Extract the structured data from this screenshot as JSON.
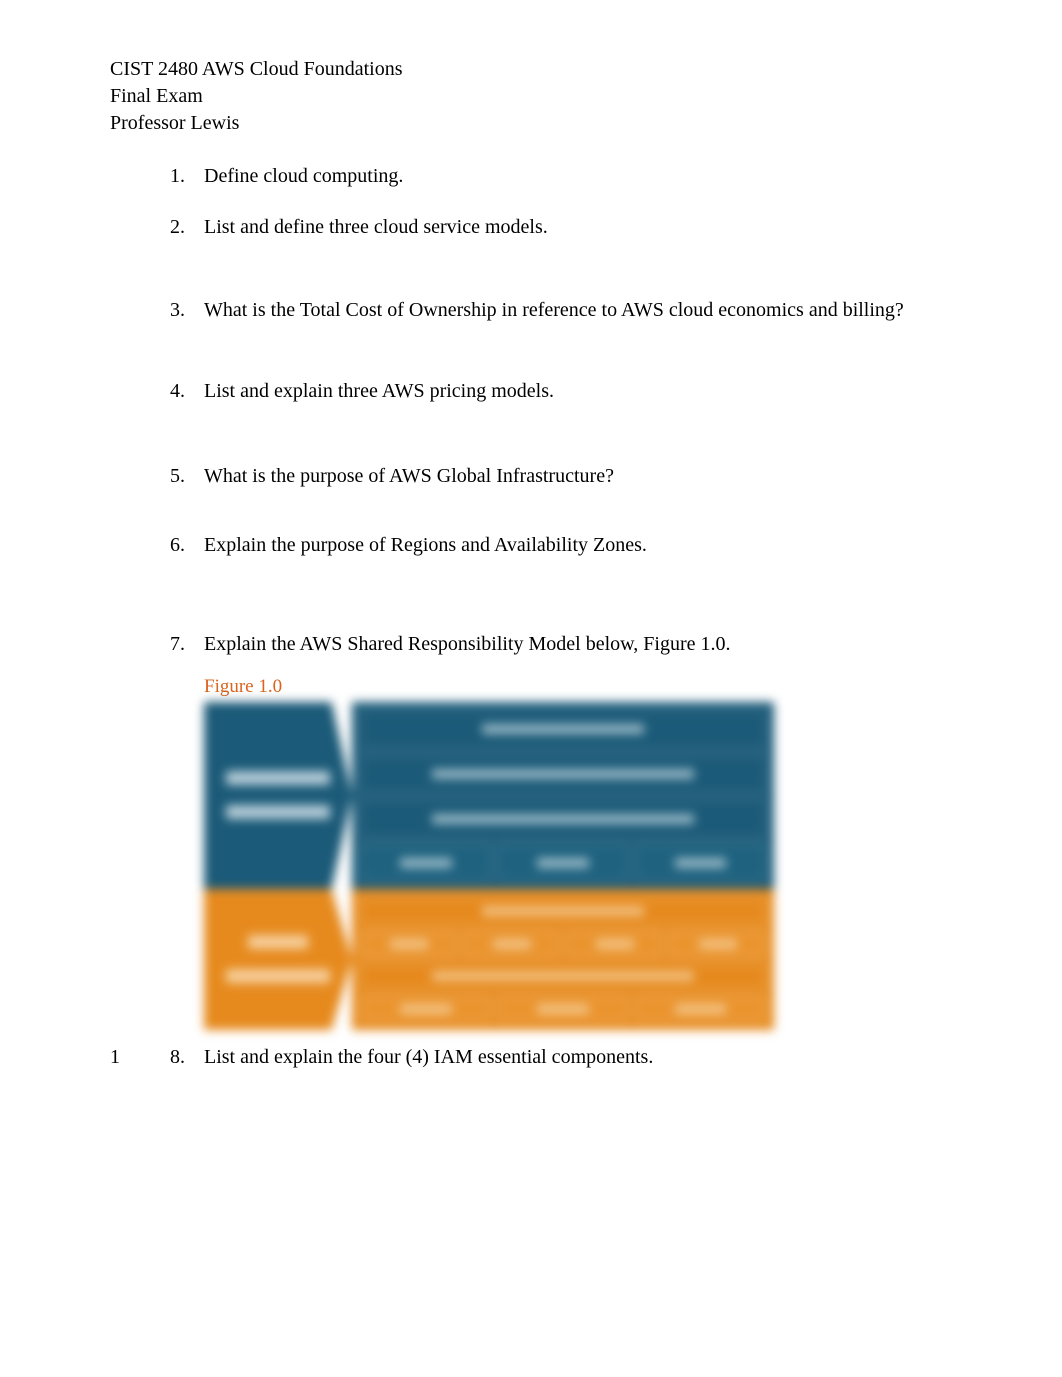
{
  "header": {
    "course": "CIST 2480 AWS Cloud Foundations",
    "doc_title": "Final Exam",
    "instructor": "Professor Lewis"
  },
  "questions": [
    {
      "num": "1.",
      "text": "Define cloud computing."
    },
    {
      "num": "2.",
      "text": "List and define three cloud service models."
    },
    {
      "num": "3.",
      "text": "What is the Total Cost of Ownership in reference to AWS cloud economics and billing?"
    },
    {
      "num": "4.",
      "text": "List and explain three AWS pricing models."
    },
    {
      "num": "5.",
      "text": "What is the purpose of AWS Global Infrastructure?"
    },
    {
      "num": "6.",
      "text": "Explain the purpose of Regions and Availability Zones."
    },
    {
      "num": "7.",
      "text": "Explain the AWS Shared Responsibility Model below, Figure 1.0."
    },
    {
      "num": "8.",
      "text": "List and explain the four (4) IAM essential components."
    }
  ],
  "figure": {
    "label": "Figure 1.0",
    "label_color": "#d9641c",
    "top_color": "#1b5a78",
    "bottom_color": "#e68a1e"
  },
  "page_number": "1"
}
